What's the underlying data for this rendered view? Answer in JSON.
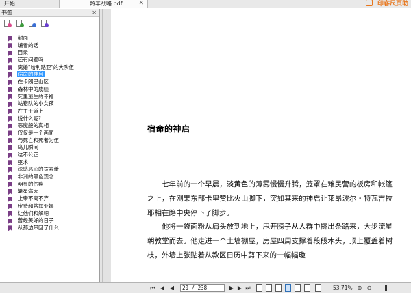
{
  "tabs": {
    "start_label": "开始",
    "doc_label": "羚羊战略.pdf",
    "close_glyph": "✕"
  },
  "brand": {
    "text": "印客尺页助"
  },
  "sidebar": {
    "header_label": "书签",
    "close_glyph": "✕",
    "tools": [
      {
        "name": "bookmark-add-icon",
        "color": "#d94a8c"
      },
      {
        "name": "bookmark-delete-icon",
        "color": "#3b9b3b"
      },
      {
        "name": "bookmark-expand-icon",
        "color": "#3b6fd4"
      },
      {
        "name": "bookmark-options-icon",
        "color": "#6a3fd1"
      }
    ],
    "bookmarks": [
      {
        "label": "封面"
      },
      {
        "label": "编者的话"
      },
      {
        "label": "目录"
      },
      {
        "label": "还有问题吗"
      },
      {
        "label": "离婚\"哈利路亚\"的大队伍"
      },
      {
        "label": "宿命的神启",
        "selected": true
      },
      {
        "label": "在卡朗巴山区"
      },
      {
        "label": "森林中的成绩"
      },
      {
        "label": "死里逃生的幸福"
      },
      {
        "label": "站错队的小女孩"
      },
      {
        "label": "在主干道上"
      },
      {
        "label": "说什么呢?"
      },
      {
        "label": "恶魔般的真相"
      },
      {
        "label": "仅仅是一个画面"
      },
      {
        "label": "与死亡和死者为伍"
      },
      {
        "label": "鸟儿瞬间"
      },
      {
        "label": "这不公正"
      },
      {
        "label": "巫术"
      },
      {
        "label": "深感恶心的贡索蕾"
      },
      {
        "label": "非洲的黑色观念"
      },
      {
        "label": "明显的伤痕"
      },
      {
        "label": "繁星满天"
      },
      {
        "label": "上帝不离不弃"
      },
      {
        "label": "皮费和蒂兹亚娜"
      },
      {
        "label": "让他们和解吧"
      },
      {
        "label": "曾经美好的日子"
      },
      {
        "label": "从那边带回了什么"
      }
    ]
  },
  "document": {
    "chapter_title": "宿命的神启",
    "paragraphs": [
      "七年前的一个早晨，淡黄色的薄雾慢慢升腾，笼罩在难民营的板房和帐篷之上，在刚果东部卡里赞比火山脚下，突如其来的神启让莱昂波尔・特瓦吉拉耶相在路中央停下了脚步。",
      "他将一袋面粉从肩头放到地上，甩开膀子从人群中挤出条路来，大步流星朝教堂而去。他走进一个土墙棚屋，房屋四周支撑着段段木头，顶上覆盖着树枝，外墙上张贴着从教区日历中剪下来的一幅幅瓊"
    ]
  },
  "statusbar": {
    "first_glyph": "⏮",
    "prev_glyph": "◀",
    "page_value": "20 / 238",
    "next_glyph": "▶",
    "last_glyph": "⏭",
    "zoom_value": "53.71%",
    "zoom_in_glyph": "⊕",
    "zoom_out_glyph": "⊖"
  }
}
